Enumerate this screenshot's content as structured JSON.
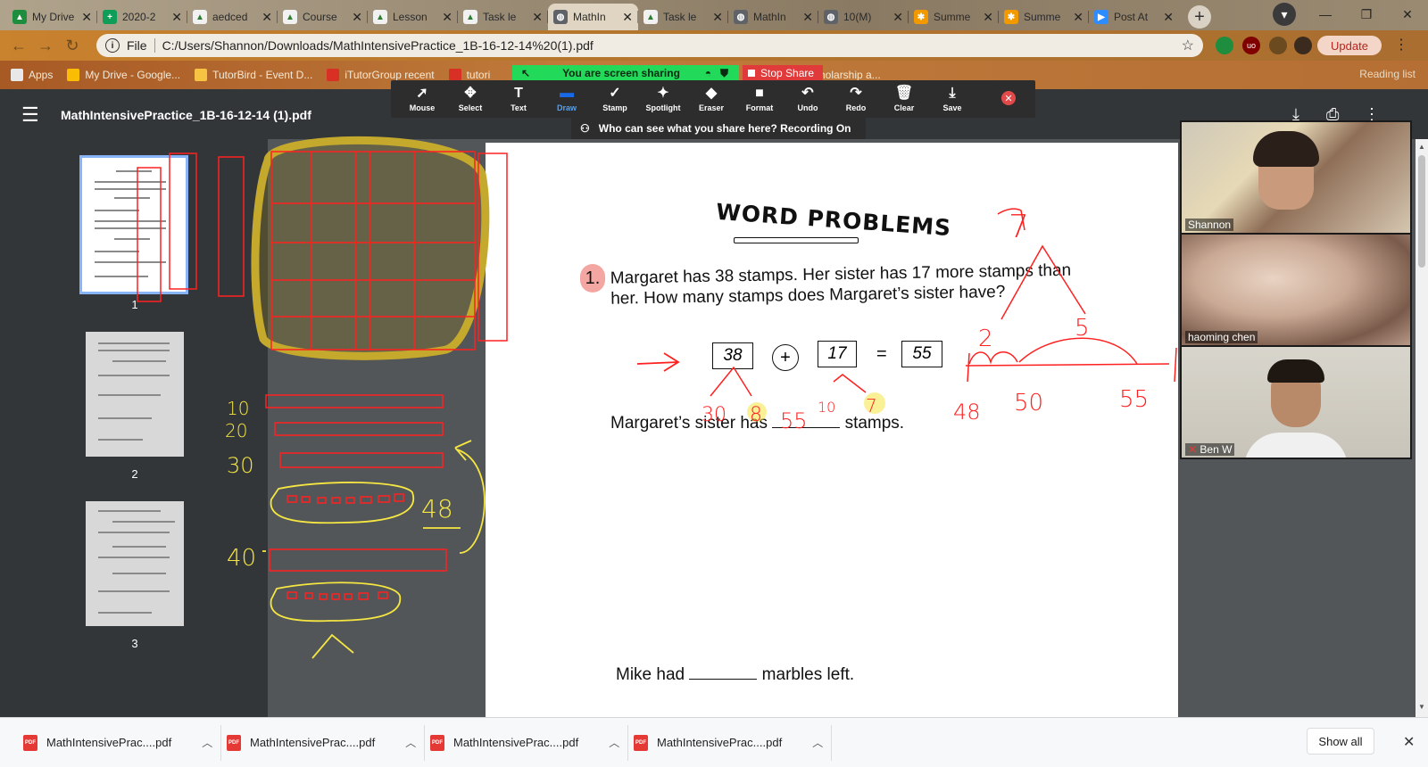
{
  "browser": {
    "tabs": [
      {
        "title": "My Drive",
        "fav_color": "#1e8e3e",
        "fav_glyph": "▲"
      },
      {
        "title": "2020-2",
        "fav_color": "#0f9d58",
        "fav_glyph": "+"
      },
      {
        "title": "aedced",
        "fav_color": "#f1f1f1",
        "fav_glyph": "▲"
      },
      {
        "title": "Course",
        "fav_color": "#f1f1f1",
        "fav_glyph": "▲"
      },
      {
        "title": "Lesson",
        "fav_color": "#f1f1f1",
        "fav_glyph": "▲"
      },
      {
        "title": "Task le",
        "fav_color": "#f1f1f1",
        "fav_glyph": "▲"
      },
      {
        "title": "MathIn",
        "fav_color": "#5f6368",
        "fav_glyph": "◍",
        "active": true
      },
      {
        "title": "Task le",
        "fav_color": "#f1f1f1",
        "fav_glyph": "▲"
      },
      {
        "title": "MathIn",
        "fav_color": "#5f6368",
        "fav_glyph": "◍"
      },
      {
        "title": "10(M)",
        "fav_color": "#5f6368",
        "fav_glyph": "◍"
      },
      {
        "title": "Summe",
        "fav_color": "#f29900",
        "fav_glyph": "✱"
      },
      {
        "title": "Summe",
        "fav_color": "#f29900",
        "fav_glyph": "✱"
      },
      {
        "title": "Post At",
        "fav_color": "#2d8cff",
        "fav_glyph": "▶"
      }
    ],
    "new_tab_glyph": "+",
    "window_controls": {
      "minimize": "—",
      "restore": "❐",
      "close": "✕"
    },
    "address": {
      "scheme": "File",
      "url": "C:/Users/Shannon/Downloads/MathIntensivePractice_1B-16-12-14%20(1).pdf"
    },
    "update_label": "Update",
    "bookmarks": [
      {
        "label": "Apps",
        "color": "#e8e8e8"
      },
      {
        "label": "My Drive - Google...",
        "color": "#fbbc04"
      },
      {
        "label": "TutorBird - Event D...",
        "color": "#f6c343"
      },
      {
        "label": "iTutorGroup recent",
        "color": "#d93025"
      },
      {
        "label": "tutori",
        "color": "#d93025"
      }
    ],
    "bookmark_hidden": "scholarship a...",
    "reading_list": "Reading list"
  },
  "zoom": {
    "sharing_label": "You are screen sharing",
    "stop_share_label": "Stop Share",
    "tools": [
      {
        "label": "Mouse",
        "icon": "➚"
      },
      {
        "label": "Select",
        "icon": "✥"
      },
      {
        "label": "Text",
        "icon": "T"
      },
      {
        "label": "Draw",
        "icon": "▬",
        "active": true
      },
      {
        "label": "Stamp",
        "icon": "✓"
      },
      {
        "label": "Spotlight",
        "icon": "✦"
      },
      {
        "label": "Eraser",
        "icon": "◆"
      },
      {
        "label": "Format",
        "icon": "■"
      },
      {
        "label": "Undo",
        "icon": "↶"
      },
      {
        "label": "Redo",
        "icon": "↷"
      },
      {
        "label": "Clear",
        "icon": "🗑"
      },
      {
        "label": "Save",
        "icon": "⤓"
      }
    ],
    "who_can_see": "Who can see what you share here? Recording On",
    "participants": [
      {
        "name": "Shannon"
      },
      {
        "name": "haoming chen"
      },
      {
        "name": "Ben W"
      }
    ]
  },
  "pdf": {
    "title": "MathIntensivePractice_1B-16-12-14 (1).pdf",
    "thumbnails": [
      {
        "num": "1"
      },
      {
        "num": "2"
      },
      {
        "num": "3"
      }
    ],
    "worksheet": {
      "heading": "WORD PROBLEMS",
      "q_number": "1.",
      "question": "Margaret has 38 stamps. Her sister has 17 more stamps than her. How many stamps does Margaret’s sister have?",
      "eq": {
        "a": "38",
        "op": "+",
        "b": "17",
        "eq": "=",
        "result": "55"
      },
      "answer_before": "Margaret’s sister has",
      "answer_after": "stamps.",
      "mike_before": "Mike had",
      "mike_after": "marbles left."
    },
    "annotations": {
      "left": [
        "10",
        "20",
        "30",
        "40",
        "48"
      ],
      "eq_marks": [
        "30",
        "8",
        "55",
        "10",
        "7"
      ],
      "number_line": [
        "7",
        "2",
        "5",
        "48",
        "50",
        "55"
      ]
    }
  },
  "downloads": {
    "files": [
      {
        "name": "MathIntensivePrac....pdf"
      },
      {
        "name": "MathIntensivePrac....pdf"
      },
      {
        "name": "MathIntensivePrac....pdf"
      },
      {
        "name": "MathIntensivePrac....pdf"
      }
    ],
    "pdf_badge": "PDF",
    "show_all": "Show all"
  }
}
